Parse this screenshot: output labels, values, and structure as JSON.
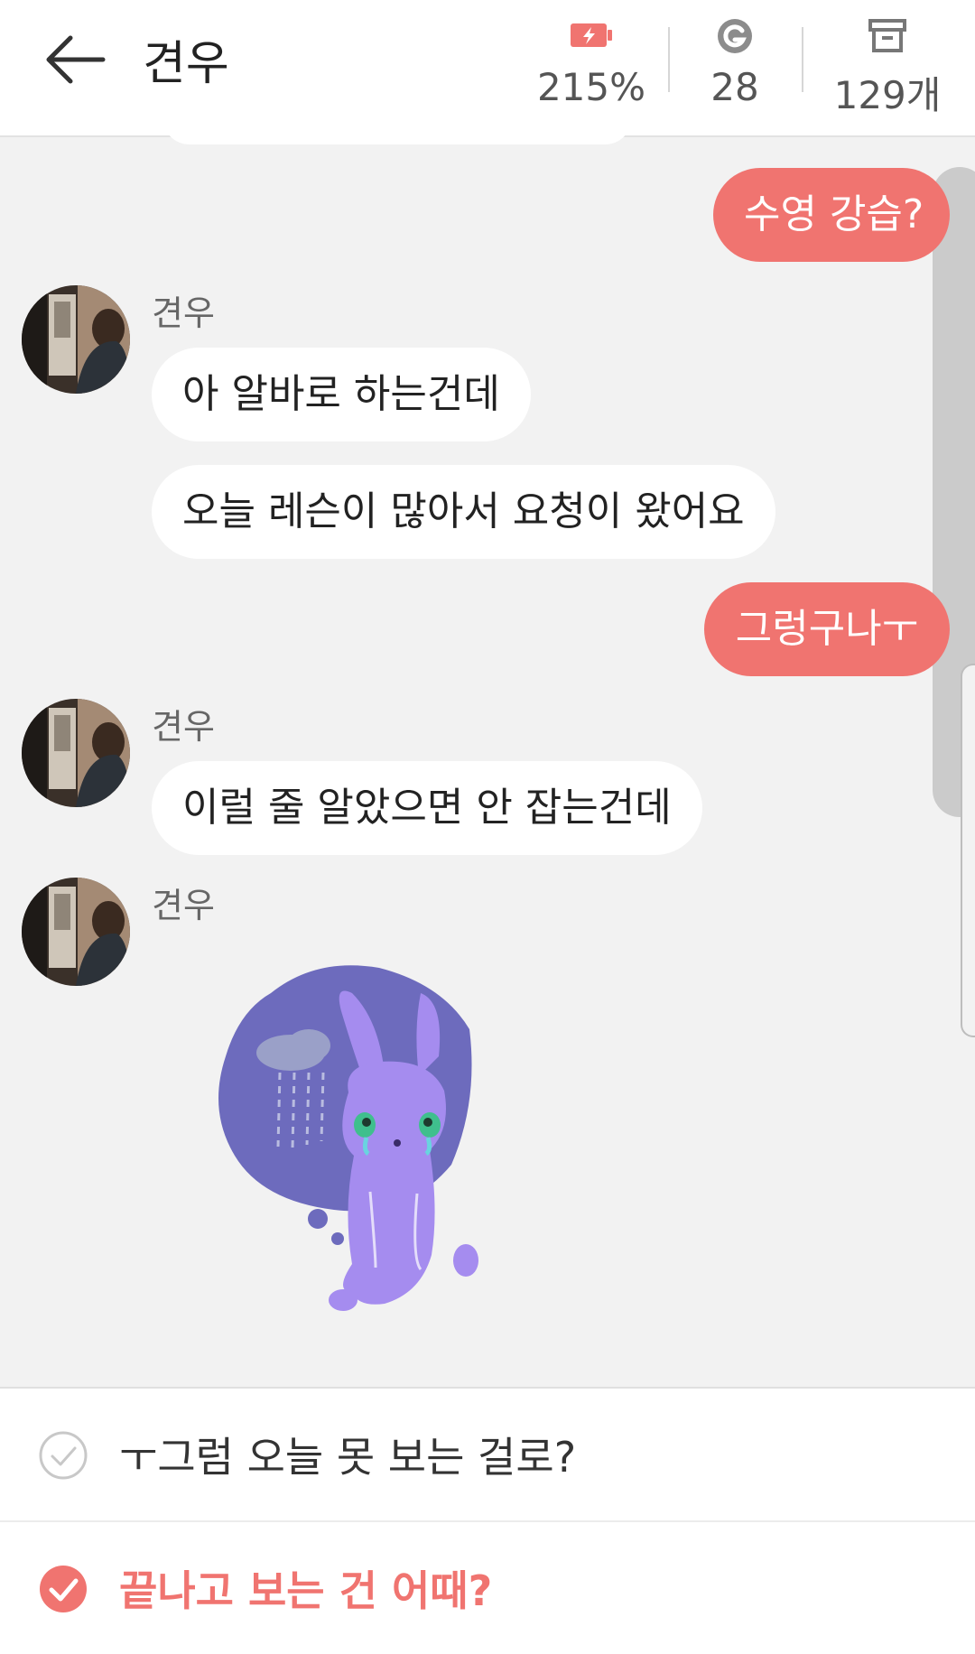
{
  "header": {
    "title": "견우",
    "stats": [
      {
        "icon": "battery-charging-icon",
        "value": "215%"
      },
      {
        "icon": "g-coin-icon",
        "value": "28"
      },
      {
        "icon": "archive-box-icon",
        "value": "129개"
      }
    ]
  },
  "messages": [
    {
      "from": "me",
      "text": "수영 강습?"
    },
    {
      "from": "견우",
      "sender": "견우",
      "text": "아 알바로 하는건데"
    },
    {
      "from": "견우",
      "text": "오늘 레슨이 많아서 요청이 왔어요"
    },
    {
      "from": "me",
      "text": "그렁구나ㅜ"
    },
    {
      "from": "견우",
      "sender": "견우",
      "text": "이럴 줄 알았으면 안 잡는건데"
    },
    {
      "from": "견우",
      "sender": "견우",
      "sticker": "sad-rabbit-rain-sticker"
    }
  ],
  "options": [
    {
      "text": "ㅜ그럼 오늘 못 보는 걸로?",
      "selected": false
    },
    {
      "text": "끝나고 보는 건 어때?",
      "selected": true
    }
  ],
  "colors": {
    "accent": "#f07470",
    "background": "#f2f2f2",
    "sticker_purple": "#a58cef",
    "sticker_cloud": "#6d6bbd"
  }
}
